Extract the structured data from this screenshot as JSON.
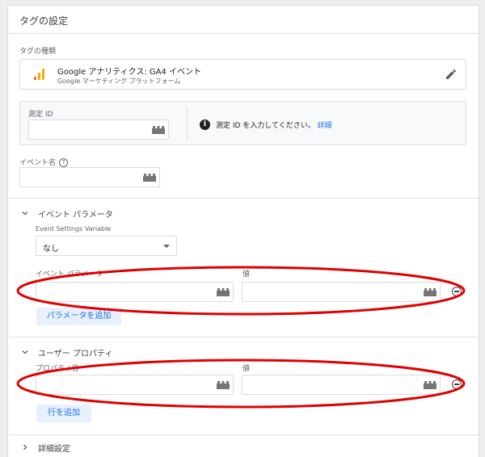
{
  "panel": {
    "title": "タグの設定"
  },
  "tag_type": {
    "label": "タグの種類",
    "name": "Google アナリティクス: GA4 イベント",
    "provider": "Google マーケティング プラットフォーム"
  },
  "measurement": {
    "label": "測定 ID",
    "value": "",
    "info_text": "測定 ID を入力してください。",
    "info_link": "詳細"
  },
  "event_name": {
    "label": "イベント名",
    "value": ""
  },
  "event_params": {
    "section_title": "イベント パラメータ",
    "settings_var_label": "Event Settings Variable",
    "settings_var_value": "なし",
    "col_param": "イベント パラメータ",
    "col_value": "値",
    "add_button": "パラメータを追加"
  },
  "user_props": {
    "section_title": "ユーザー プロパティ",
    "col_property": "プロパティ名",
    "col_value": "値",
    "add_button": "行を追加"
  },
  "advanced": {
    "section_title": "詳細設定"
  },
  "colors": {
    "accent": "#1a73e8",
    "annotation": "#e00000",
    "ga_orange": "#f9ab00",
    "ga_dark": "#e37400"
  }
}
